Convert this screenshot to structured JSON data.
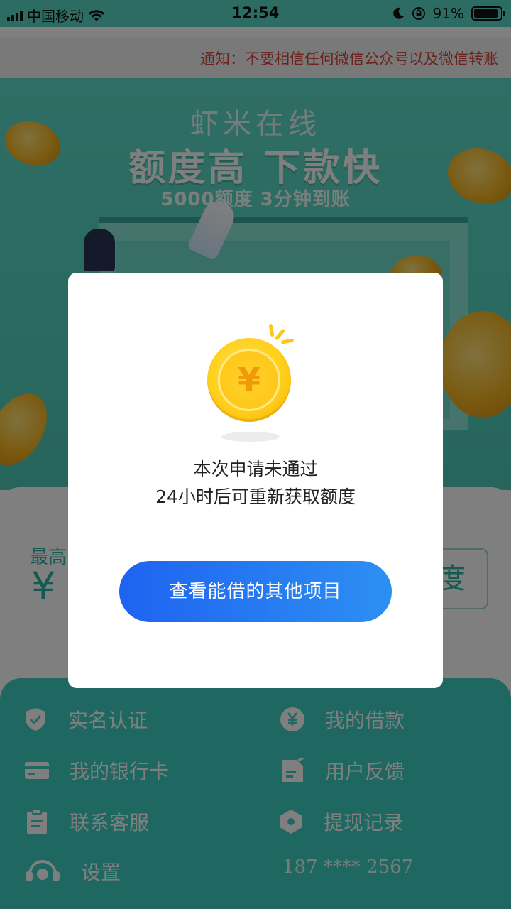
{
  "status_bar": {
    "carrier": "中国移动",
    "time": "12:54",
    "battery_percent": "91%",
    "battery_level": 0.91,
    "icons": [
      "signal-icon",
      "wifi-icon",
      "moon-icon",
      "rotation-lock-icon",
      "battery-icon"
    ]
  },
  "notice": {
    "text": "通知：不要相信任何微信公众号以及微信转账"
  },
  "banner": {
    "subtitle": "虾米在线",
    "title": "额度高  下款快",
    "tagline": "5000额度  3分钟到账"
  },
  "card": {
    "label": "最高",
    "currency": "¥",
    "button_label": "度"
  },
  "menu": {
    "items": [
      {
        "label": "实名认证",
        "icon": "shield-check-icon"
      },
      {
        "label": "我的借款",
        "icon": "yen-circle-icon"
      },
      {
        "label": "我的银行卡",
        "icon": "bank-card-icon"
      },
      {
        "label": "用户反馈",
        "icon": "feedback-icon"
      },
      {
        "label": "联系客服",
        "icon": "clipboard-icon"
      },
      {
        "label": "提现记录",
        "icon": "hexagon-icon"
      },
      {
        "label": "设置",
        "icon": "headset-icon"
      }
    ],
    "phone": "187 **** 2567"
  },
  "modal": {
    "coin_symbol": "¥",
    "message_line1": "本次申请未通过",
    "message_line2": "24小时后可重新获取额度",
    "button_label": "查看能借的其他项目"
  },
  "colors": {
    "accent_teal": "#3ed0c3",
    "notice_red": "#d8473c",
    "button_blue_start": "#1e63f0",
    "button_blue_end": "#2d8ff2",
    "coin_gold": "#ffcf1a"
  }
}
